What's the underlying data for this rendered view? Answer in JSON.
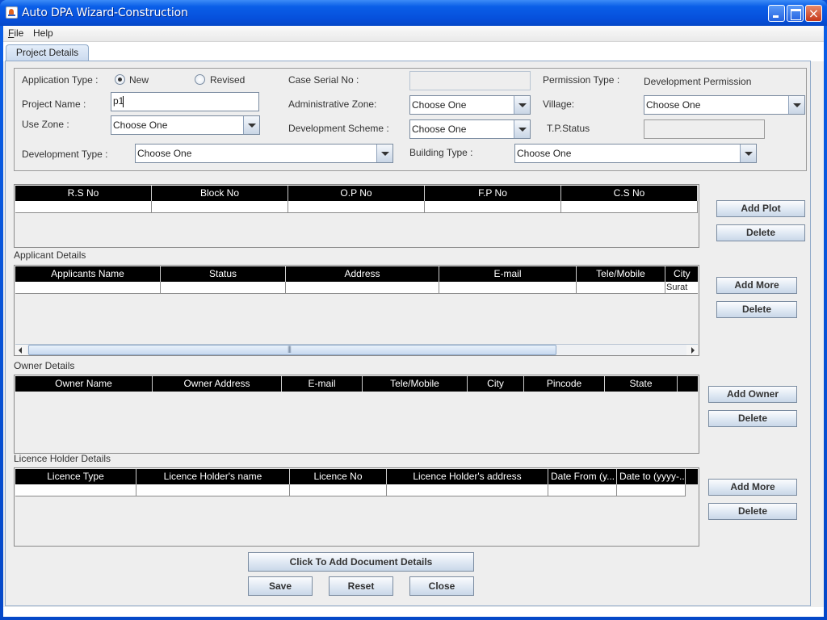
{
  "window": {
    "title": "Auto DPA Wizard-Construction",
    "controls": {
      "minimize": "minimize",
      "maximize": "maximize",
      "close": "×"
    }
  },
  "menubar": {
    "items": [
      {
        "label": "File",
        "mnemonic": "F",
        "rest": "ile"
      },
      {
        "label": "Help"
      }
    ]
  },
  "tabs": [
    {
      "label": "Project Details",
      "selected": true
    }
  ],
  "form": {
    "application_type": {
      "label": "Application Type :",
      "options": [
        {
          "label": "New",
          "selected": true
        },
        {
          "label": "Revised",
          "selected": false
        }
      ]
    },
    "case_serial_no": {
      "label": "Case Serial No :",
      "value": ""
    },
    "permission_type": {
      "label": "Permission Type :",
      "value": "Development Permission"
    },
    "project_name": {
      "label": "Project Name :",
      "value": "p1"
    },
    "administrative_zone": {
      "label": "Administrative Zone:",
      "value": "Choose One"
    },
    "village": {
      "label": "Village:",
      "value": "Choose One"
    },
    "use_zone": {
      "label": "Use Zone :",
      "value": "Choose One"
    },
    "development_scheme": {
      "label": "Development Scheme :",
      "value": "Choose One"
    },
    "tp_status": {
      "label": "T.P.Status",
      "value": ""
    },
    "development_type": {
      "label": "Development Type :",
      "value": "Choose One"
    },
    "building_type": {
      "label": "Building Type :",
      "value": "Choose One"
    }
  },
  "plot_table": {
    "columns": [
      "R.S No",
      "Block No",
      "O.P No",
      "F.P No",
      "C.S No"
    ],
    "rows": [
      [
        "",
        "",
        "",
        "",
        ""
      ]
    ],
    "buttons": {
      "add": "Add Plot",
      "delete": "Delete"
    }
  },
  "applicant_table": {
    "title": "Applicant Details",
    "columns": [
      "Applicants Name",
      "Status",
      "Address",
      "E-mail",
      "Tele/Mobile",
      "City"
    ],
    "rows": [
      [
        "",
        "",
        "",
        "",
        "",
        "Surat"
      ]
    ],
    "buttons": {
      "add": "Add More",
      "delete": "Delete"
    }
  },
  "owner_table": {
    "title": "Owner Details",
    "columns": [
      "Owner Name",
      "Owner Address",
      "E-mail",
      "Tele/Mobile",
      "City",
      "Pincode",
      "State"
    ],
    "rows": [],
    "buttons": {
      "add": "Add Owner",
      "delete": "Delete"
    }
  },
  "licence_table": {
    "title": "Licence Holder Details",
    "columns": [
      "Licence Type",
      "Licence Holder's name",
      "Licence No",
      "Licence Holder's address",
      "Date From (y...",
      "Date to (yyyy-..."
    ],
    "rows": [
      [
        "",
        "",
        "",
        "",
        "",
        ""
      ]
    ],
    "buttons": {
      "add": "Add More",
      "delete": "Delete"
    }
  },
  "footer": {
    "add_documents": "Click To Add Document Details",
    "save": "Save",
    "reset": "Reset",
    "close": "Close"
  }
}
